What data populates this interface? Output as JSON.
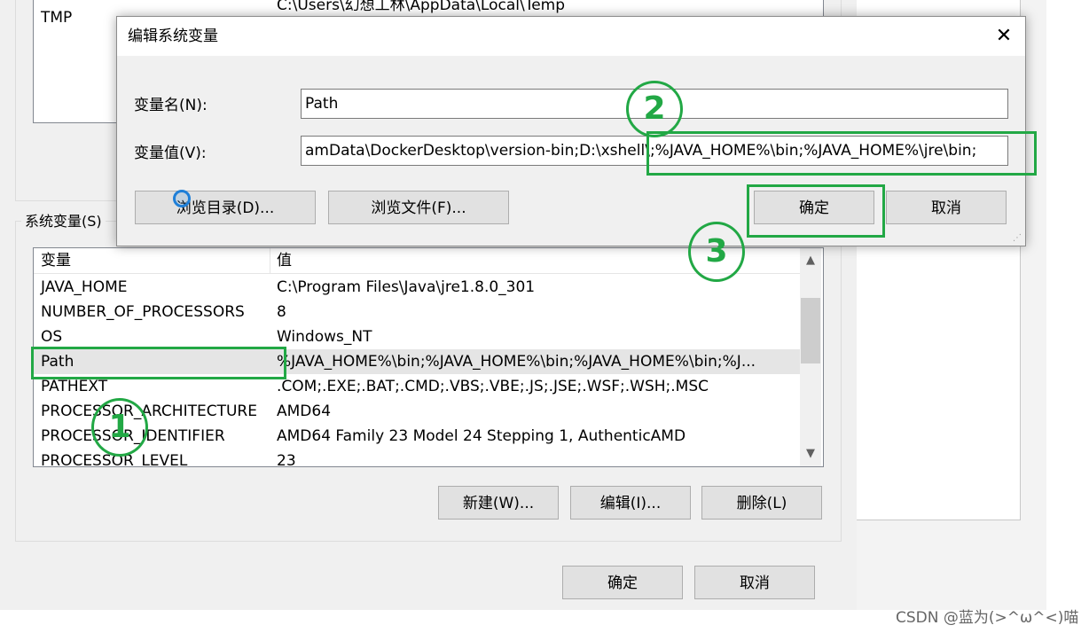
{
  "user_vars": {
    "partial_row": {
      "name": "TMP",
      "value": "C:\\Users\\幻想工林\\AppData\\Local\\Temp"
    }
  },
  "system_vars": {
    "group_label": "系统变量(S)",
    "columns": [
      "变量",
      "值"
    ],
    "rows": [
      {
        "name": "JAVA_HOME",
        "value": "C:\\Program Files\\Java\\jre1.8.0_301"
      },
      {
        "name": "NUMBER_OF_PROCESSORS",
        "value": "8"
      },
      {
        "name": "OS",
        "value": "Windows_NT"
      },
      {
        "name": "Path",
        "value": "%JAVA_HOME%\\bin;%JAVA_HOME%\\bin;%JAVA_HOME%\\bin;%J..."
      },
      {
        "name": "PATHEXT",
        "value": ".COM;.EXE;.BAT;.CMD;.VBS;.VBE;.JS;.JSE;.WSF;.WSH;.MSC"
      },
      {
        "name": "PROCESSOR_ARCHITECTURE",
        "value": "AMD64"
      },
      {
        "name": "PROCESSOR_IDENTIFIER",
        "value": "AMD64 Family 23 Model 24 Stepping 1, AuthenticAMD"
      },
      {
        "name": "PROCESSOR_LEVEL",
        "value": "23"
      }
    ],
    "buttons": {
      "new": "新建(W)...",
      "edit": "编辑(I)...",
      "delete": "删除(L)"
    }
  },
  "main_buttons": {
    "ok": "确定",
    "cancel": "取消"
  },
  "dialog": {
    "title": "编辑系统变量",
    "close_glyph": "✕",
    "name_label": "变量名(N):",
    "name_value": "Path",
    "value_label": "变量值(V):",
    "value_value": "amData\\DockerDesktop\\version-bin;D:\\xshell\\;%JAVA_HOME%\\bin;%JAVA_HOME%\\jre\\bin;",
    "browse_dir": "浏览目录(D)...",
    "browse_file": "浏览文件(F)...",
    "ok": "确定",
    "cancel": "取消"
  },
  "annotations": {
    "one": "1",
    "two": "2",
    "three": "3",
    "color": "#22a845"
  },
  "watermark": "CSDN @蓝为(>^ω^<)喵"
}
